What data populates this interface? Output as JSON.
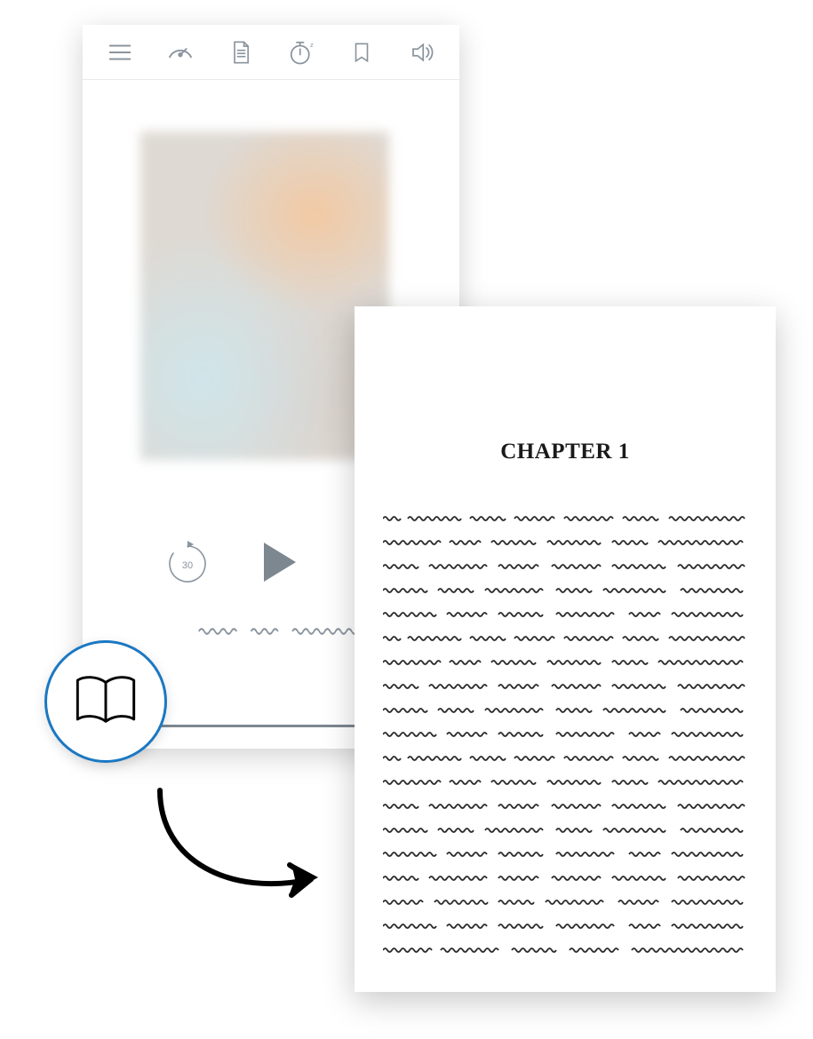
{
  "audio_player": {
    "toolbar": {
      "menu_icon": "menu",
      "speed_icon": "playback-speed",
      "document_icon": "document",
      "timer_icon": "sleep-timer",
      "bookmark_icon": "bookmark",
      "volume_icon": "volume"
    },
    "controls": {
      "rewind_seconds": "30",
      "play_icon": "play"
    }
  },
  "reader": {
    "chapter_title": "CHAPTER 1"
  },
  "action_button": {
    "icon": "open-book"
  }
}
